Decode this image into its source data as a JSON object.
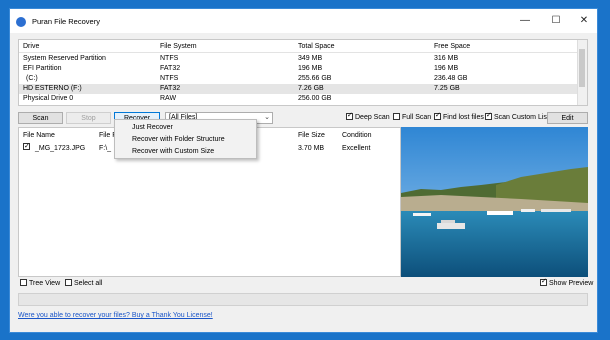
{
  "window": {
    "title": "Puran File Recovery"
  },
  "title_controls": {
    "minimize": "—",
    "maximize": "☐",
    "close": "✕"
  },
  "drives": {
    "headers": [
      "Drive",
      "File System",
      "Total Space",
      "Free Space"
    ],
    "rows": [
      [
        "System Reserved Partition",
        "NTFS",
        "349 MB",
        "316 MB"
      ],
      [
        "EFI Partition",
        "FAT32",
        "196 MB",
        "196 MB"
      ],
      [
        "(C:)",
        "NTFS",
        "255.66 GB",
        "236.48 GB"
      ],
      [
        "HD ESTERNO (F:)",
        "FAT32",
        "7.26 GB",
        "7.25 GB"
      ],
      [
        "Physical Drive 0",
        "RAW",
        "256.00 GB",
        ""
      ]
    ],
    "selected_index": 3
  },
  "toolbar": {
    "scan": "Scan",
    "stop": "Stop",
    "recover": "Recover",
    "filter_value": "[All Files]",
    "deep_scan": "Deep Scan",
    "full_scan": "Full Scan",
    "find_lost": "Find lost files",
    "scan_custom": "Scan Custom List",
    "edit": "Edit"
  },
  "options": {
    "deep_scan": true,
    "full_scan": false,
    "find_lost": true,
    "scan_custom": true
  },
  "recover_menu": {
    "items": [
      "Just Recover",
      "Recover with Folder Structure",
      "Recover with Custom Size"
    ]
  },
  "files": {
    "headers": [
      "File Name",
      "File P",
      "File Size",
      "Condition"
    ],
    "rows": [
      {
        "name": "_MG_1723.JPG",
        "path": "F:\\_",
        "size": "3.70 MB",
        "condition": "Excellent",
        "checked": true
      }
    ]
  },
  "bottom": {
    "tree_view": "Tree View",
    "select_all": "Select all",
    "show_preview": "Show Preview",
    "tree_view_checked": false,
    "select_all_checked": false,
    "show_preview_checked": true
  },
  "footer": {
    "link": "Were you able to recover your files? Buy a Thank You License!"
  }
}
